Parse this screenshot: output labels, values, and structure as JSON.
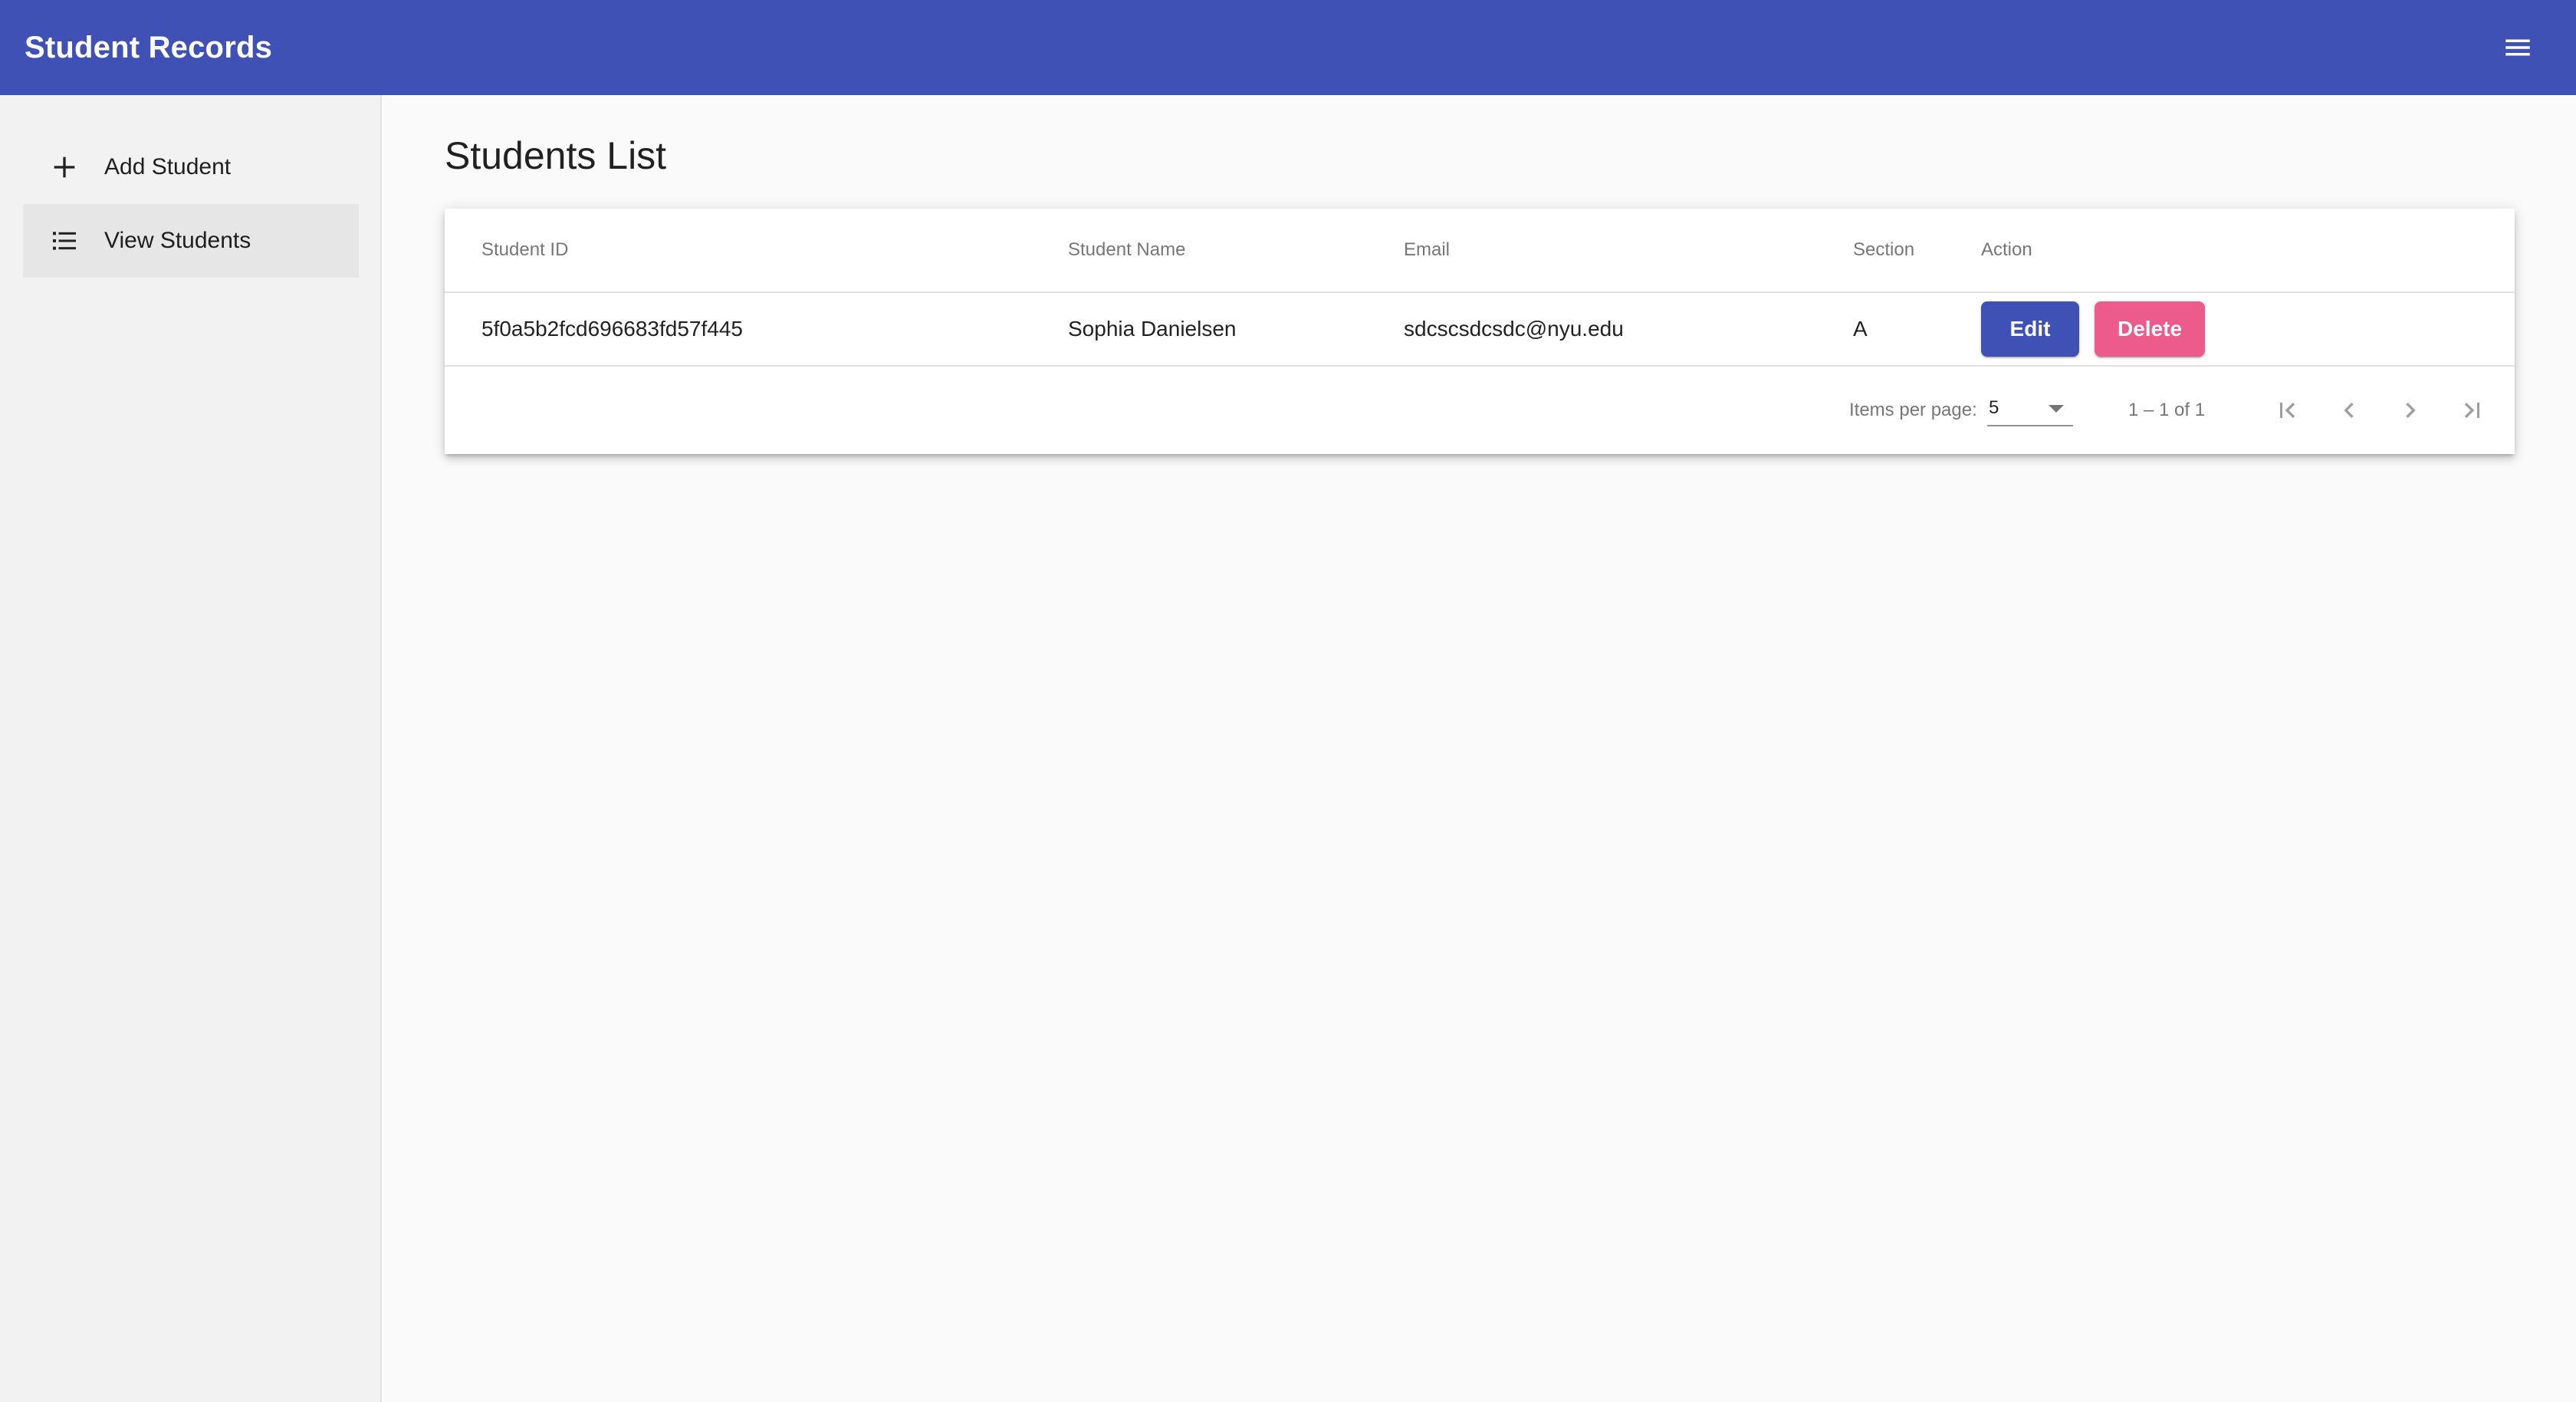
{
  "header": {
    "title": "Student Records",
    "menu_icon": "menu-icon",
    "background_color": "#3f51b5"
  },
  "sidenav": {
    "items": [
      {
        "label": "Add Student",
        "icon": "plus-icon",
        "active": false
      },
      {
        "label": "View Students",
        "icon": "list-icon",
        "active": true
      }
    ]
  },
  "main": {
    "title": "Students List",
    "table": {
      "columns": [
        "Student ID",
        "Student Name",
        "Email",
        "Section",
        "Action"
      ],
      "rows": [
        {
          "id": "5f0a5b2fcd696683fd57f445",
          "name": "Sophia Danielsen",
          "email": "sdcscsdcsdc@nyu.edu",
          "section": "A",
          "edit_label": "Edit",
          "delete_label": "Delete"
        }
      ]
    },
    "paginator": {
      "items_per_page_label": "Items per page:",
      "items_per_page_value": "5",
      "range_label": "1 – 1 of 1"
    }
  },
  "colors": {
    "primary": "#3f51b5",
    "accent": "#ec5b8b"
  }
}
